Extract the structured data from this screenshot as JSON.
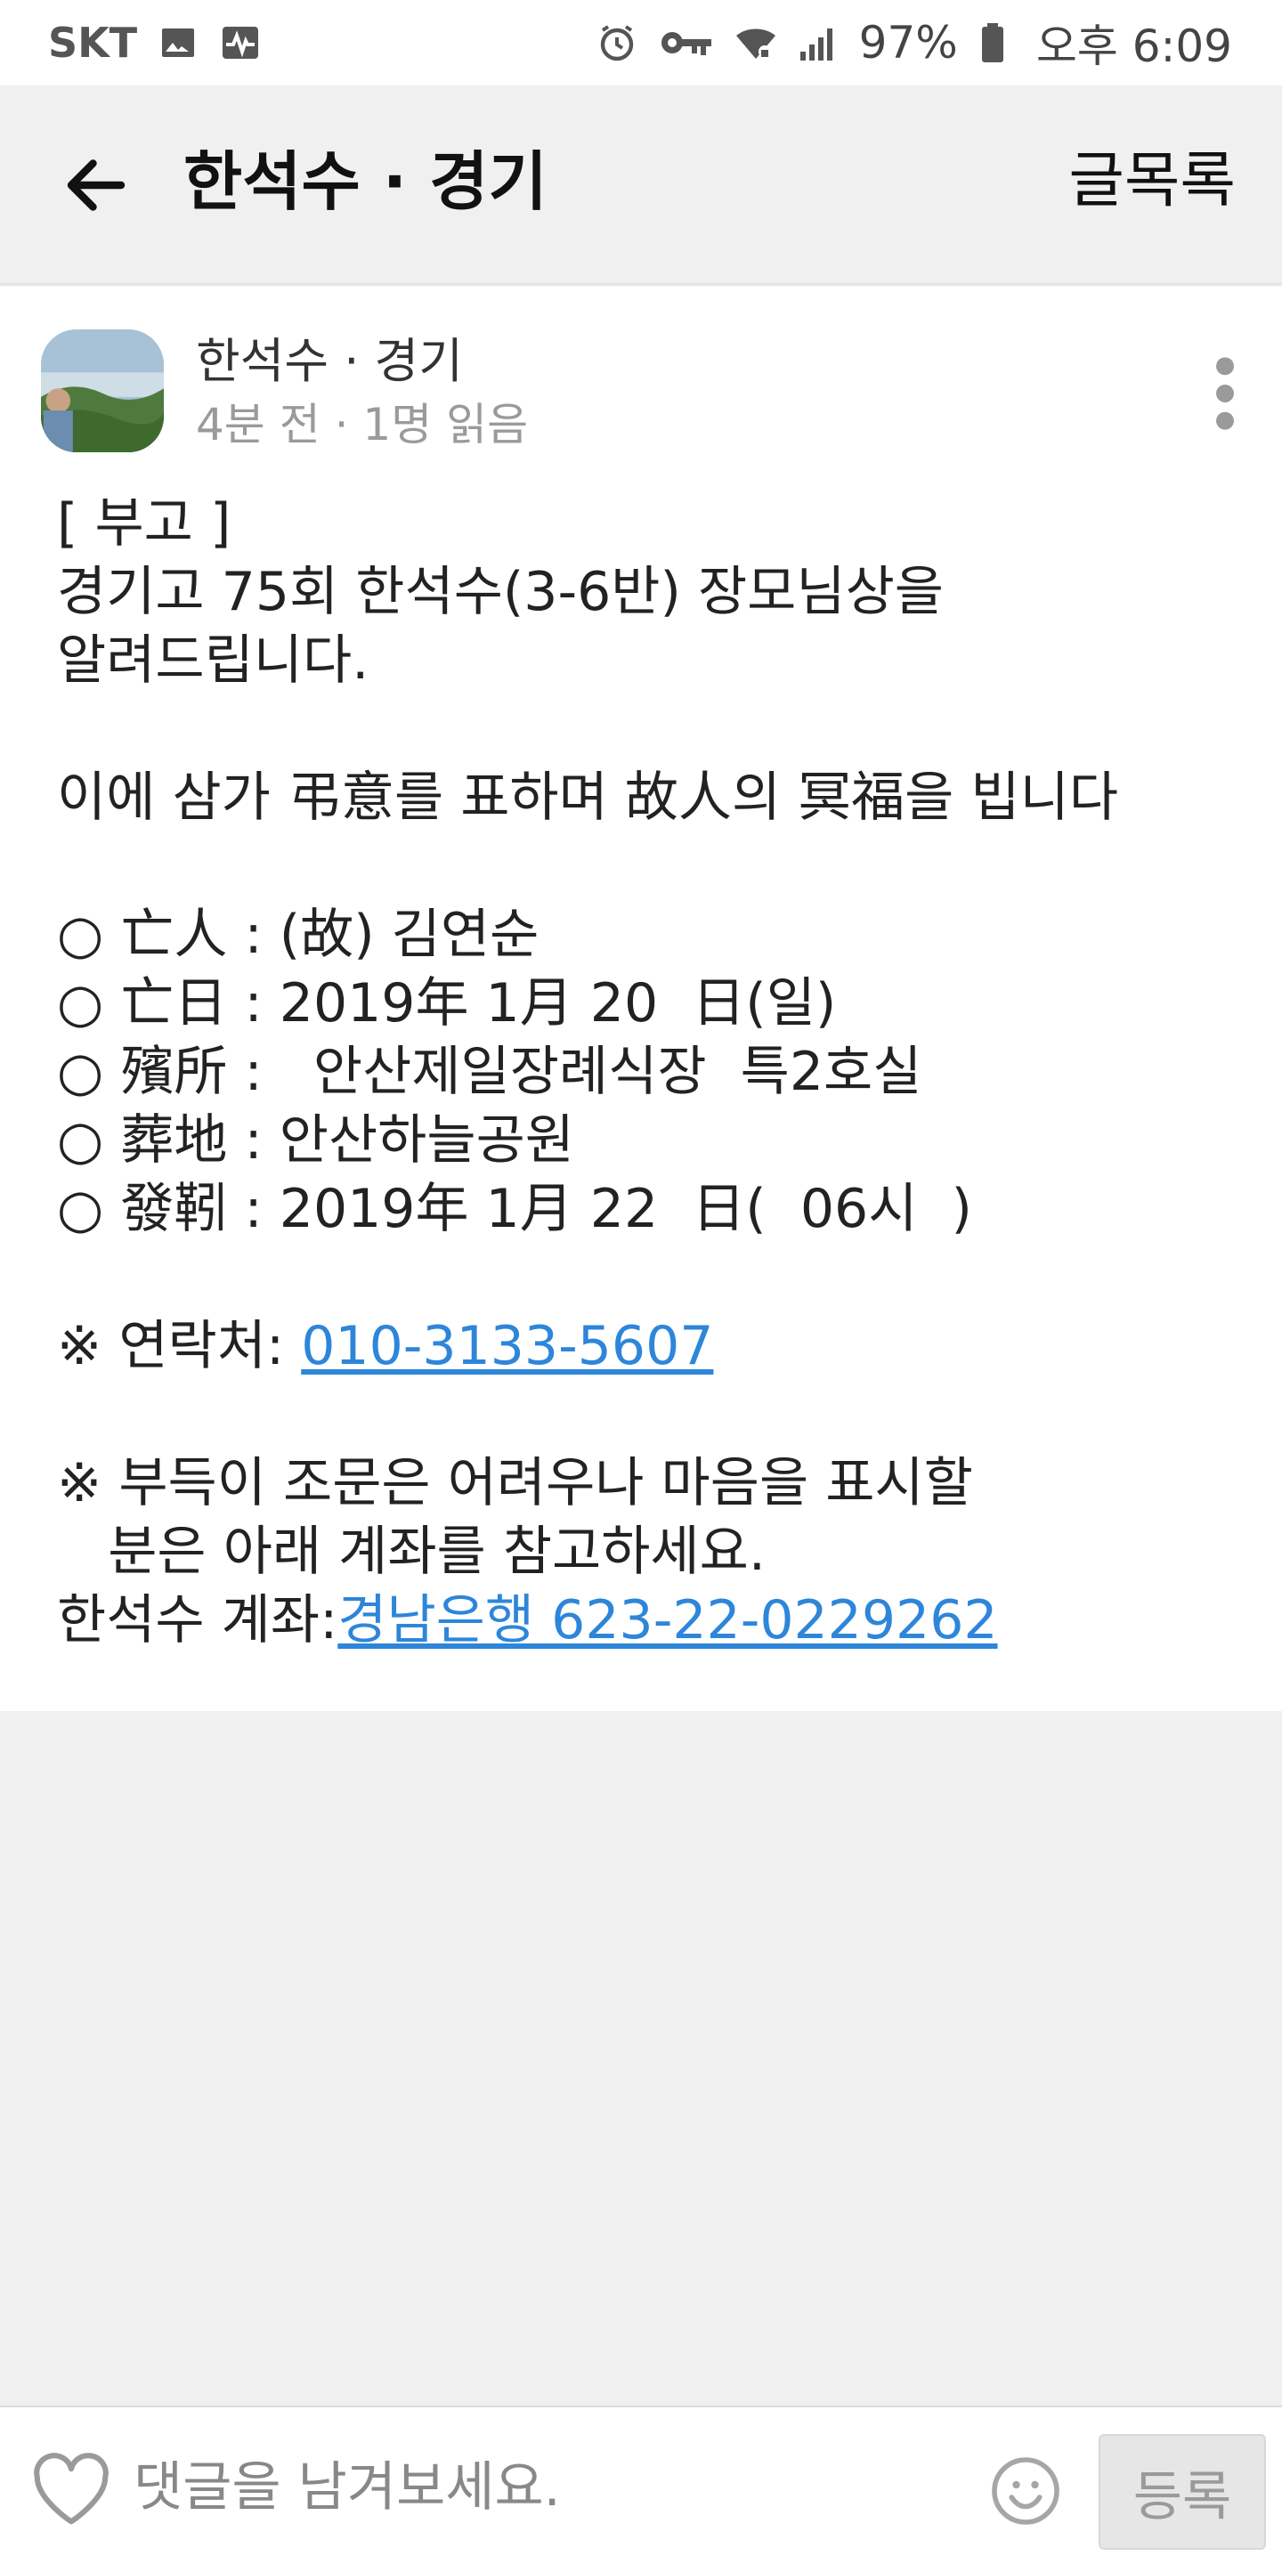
{
  "status_bar": {
    "carrier": "SKT",
    "battery": "97%",
    "time": "오후 6:09",
    "icons": [
      "image-icon",
      "activity-icon",
      "alarm-icon",
      "key-icon",
      "wifi-icon",
      "signal-icon",
      "battery-icon"
    ]
  },
  "header": {
    "title": "한석수 · 경기",
    "list_label": "글목록",
    "background": "#f0f0f0"
  },
  "post": {
    "author": "한석수 · 경기",
    "meta": "4분 전 · 1명 읽음",
    "body": {
      "l1": "[ 부고 ]",
      "l2": "경기고 75회 한석수(3-6반) 장모님상을",
      "l3": "알려드립니다.",
      "l4": "이에 삼가 弔意를 표하며 故人의 冥福을 빕니다",
      "l5": "○ 亡人 : (故) 김연순",
      "l6": "○ 亡日 : 2019年 1月 20  日(일)",
      "l7": "○ 殯所 :   안산제일장례식장  특2호실",
      "l8": "○ 葬地 : 안산하늘공원",
      "l9": "○ 發靷 : 2019年 1月 22  日(  06시  )",
      "contact_label": "※ 연락처: ",
      "contact_phone": "010-3133-5607",
      "l11": "※ 부득이 조문은 어려우나 마음을 표시할",
      "l12": "   분은 아래 계좌를 참고하세요.",
      "account_label": "한석수 계좌:",
      "account_value": "경남은행 623-22-0229262"
    },
    "link_color": "#2d86d9"
  },
  "comment_bar": {
    "placeholder": "댓글을 남겨보세요.",
    "submit_label": "등록"
  }
}
